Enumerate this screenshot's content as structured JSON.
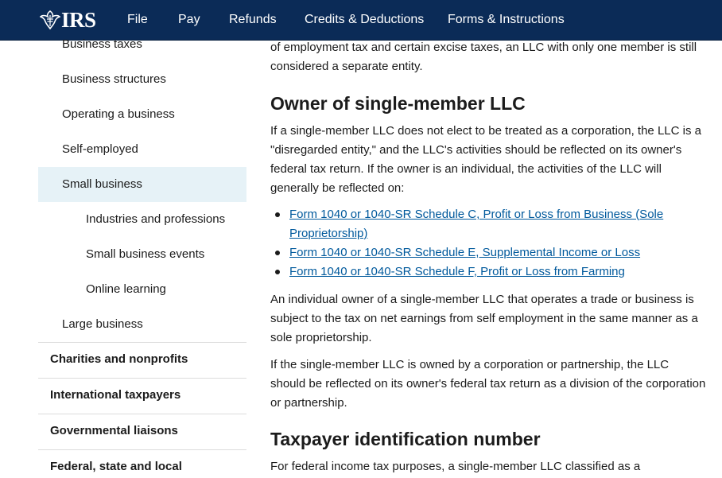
{
  "header": {
    "logo_text": "IRS",
    "nav": [
      "File",
      "Pay",
      "Refunds",
      "Credits & Deductions",
      "Forms & Instructions"
    ]
  },
  "sidebar": {
    "sub_items": [
      {
        "label": "Business taxes",
        "active": false
      },
      {
        "label": "Business structures",
        "active": false
      },
      {
        "label": "Operating a business",
        "active": false
      },
      {
        "label": "Self-employed",
        "active": false
      },
      {
        "label": "Small business",
        "active": true
      },
      {
        "label": "Industries and professions",
        "active": false
      },
      {
        "label": "Small business events",
        "active": false
      },
      {
        "label": "Online learning",
        "active": false
      },
      {
        "label": "Large business",
        "active": false
      }
    ],
    "top_items": [
      "Charities and nonprofits",
      "International taxpayers",
      "Governmental liaisons",
      "Federal, state and local"
    ]
  },
  "main": {
    "intro_para": "of employment tax and certain excise taxes, an LLC with only one member is still considered a separate entity.",
    "heading_1": "Owner of single-member LLC",
    "para_1": "If a single-member LLC does not elect to be treated as a corporation, the LLC is a \"disregarded entity,\" and the LLC's activities should be reflected on its owner's federal tax return. If the owner is an individual, the activities of the LLC will generally be reflected on:",
    "links": [
      "Form 1040 or 1040-SR Schedule C, Profit or Loss from Business (Sole Proprietorship)",
      "Form 1040 or 1040-SR Schedule E, Supplemental Income or Loss",
      "Form 1040 or 1040-SR Schedule F, Profit or Loss from Farming"
    ],
    "para_2": "An individual owner of a single-member LLC that operates a trade or business is subject to the tax on net earnings from self employment in the same manner as a sole proprietorship.",
    "para_3": "If the single-member LLC is owned by a corporation or partnership, the LLC should be reflected on its owner's federal tax return as a division of the corporation or partnership.",
    "heading_2": "Taxpayer identification number",
    "para_4": "For federal income tax purposes, a single-member LLC classified as a disregarded"
  },
  "colors": {
    "header_bg": "#0b2b57",
    "link": "#00599c",
    "active_bg": "#e6f2f7"
  }
}
